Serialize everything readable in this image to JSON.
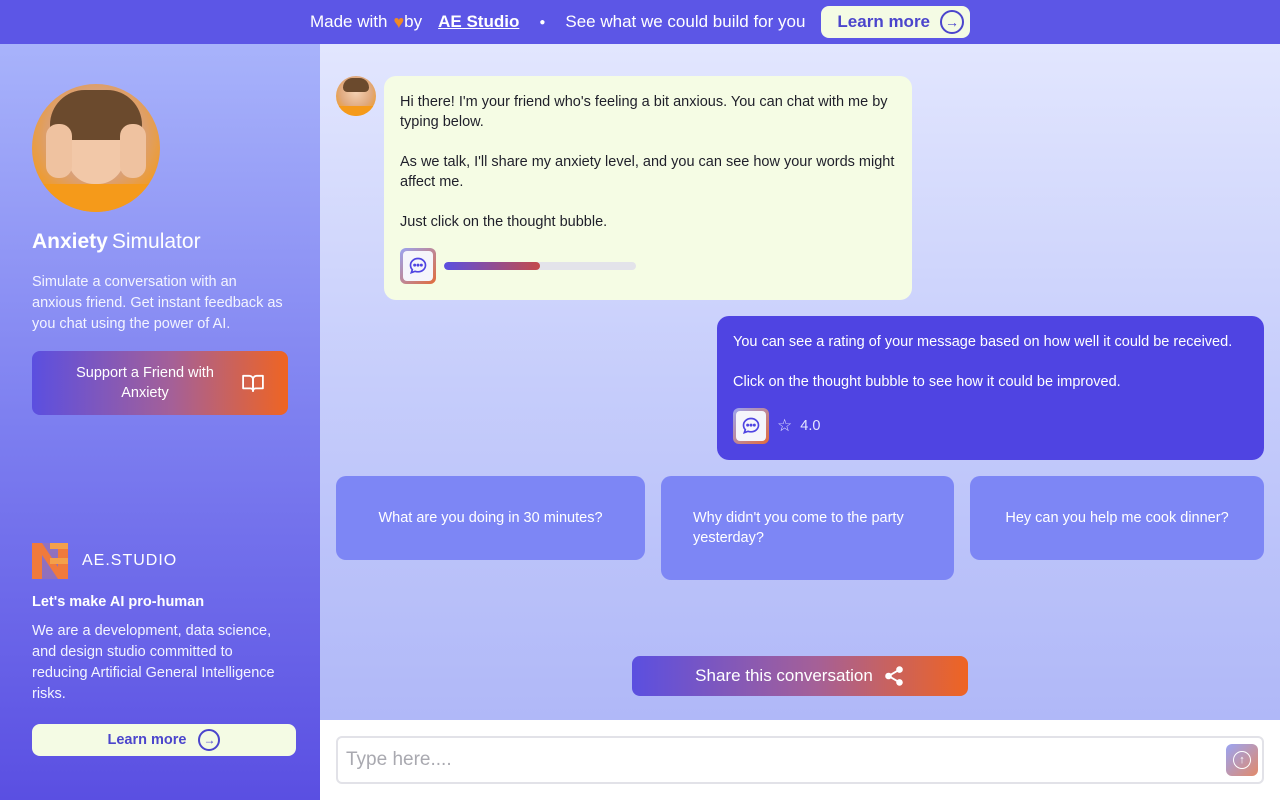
{
  "banner": {
    "made_with": "Made with",
    "by": "by",
    "ae_link": "AE Studio",
    "cta_text": "See what we could build for you",
    "learn_more": "Learn more"
  },
  "sidebar": {
    "title_bold": "Anxiety",
    "title_rest": "Simulator",
    "description": "Simulate a conversation with an anxious friend. Get instant feedback as you chat using the power of AI.",
    "support_button": "Support a Friend with Anxiety",
    "company_name": "AE.STUDIO",
    "tagline": "Let's make AI pro-human",
    "about": "We are a development, data science, and design studio committed to reducing Artificial General Intelligence risks.",
    "learn_more": "Learn more"
  },
  "chat": {
    "friend_message": {
      "paragraphs": [
        "Hi there! I'm your friend who's feeling a bit anxious. You can chat with me by typing below.",
        "As we talk, I'll share my anxiety level, and you can see how your words might affect me.",
        "Just click on the thought bubble."
      ],
      "anxiety_level": 0.5
    },
    "user_message": {
      "paragraphs": [
        "You can see a rating of your message based on how well it could be received.",
        "Click on the thought bubble to see how it could be improved."
      ],
      "rating": "4.0"
    },
    "suggestions": [
      "What are you doing in 30 minutes?",
      "Why didn't you come to the party yesterday?",
      "Hey can you help me cook dinner?"
    ],
    "share_button": "Share this conversation"
  },
  "input": {
    "placeholder": "Type here....",
    "value": ""
  },
  "colors": {
    "banner": "#5c56e6",
    "accent": "#4f44e2",
    "friend_bubble": "#f5fce4",
    "suggestion": "#7d86f5",
    "orange": "#ef6422"
  },
  "icons": {
    "heart": "heart-icon",
    "arrow": "arrow-right-circle-icon",
    "book": "book-open-icon",
    "thought": "chat-bubble-icon",
    "star": "star-icon",
    "share": "share-icon",
    "send": "send-arrow-icon"
  }
}
